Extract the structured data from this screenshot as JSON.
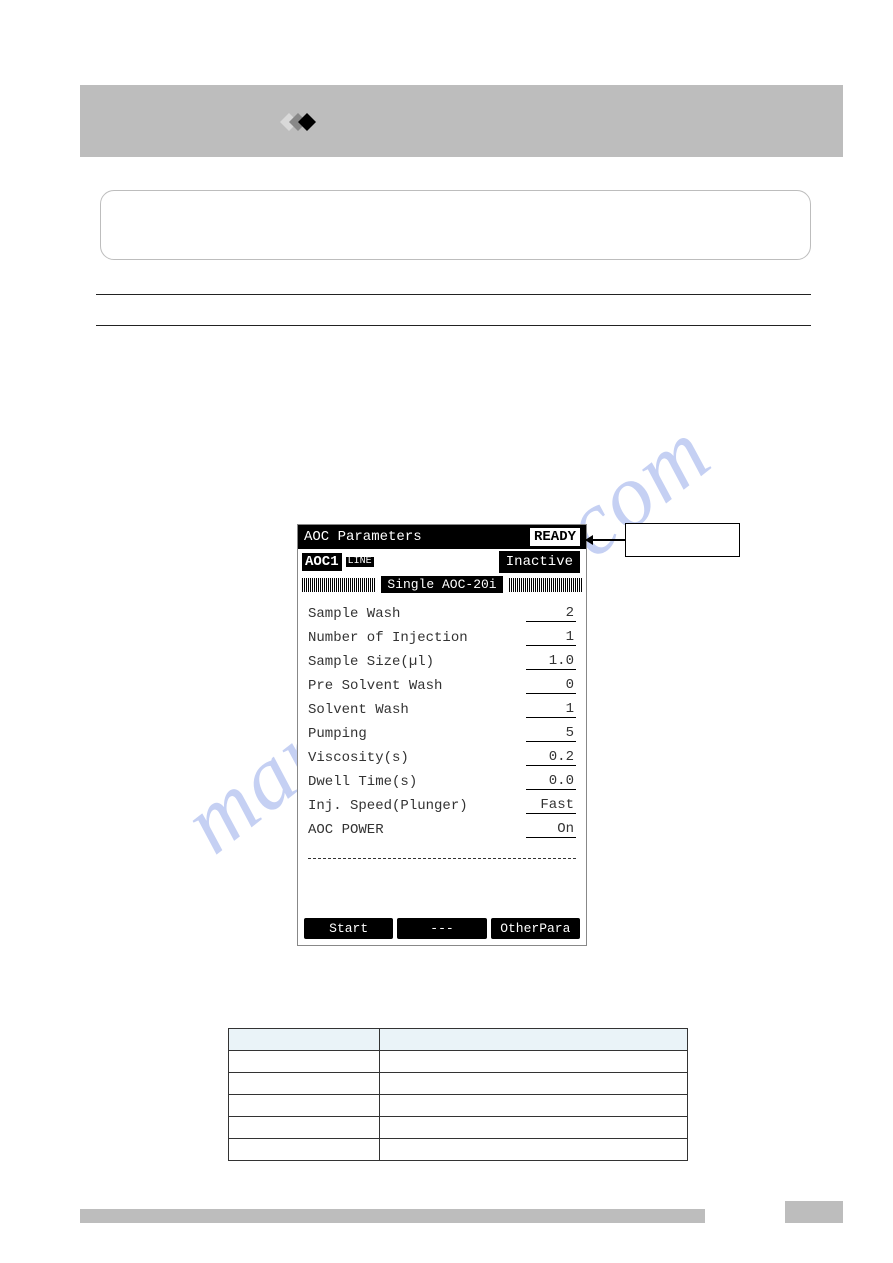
{
  "watermark": "manualslive.com",
  "lcd": {
    "header_title": "AOC Parameters",
    "ready": "READY",
    "aoc1": "AOC1",
    "line_icon": "LINE",
    "inactive": "Inactive",
    "barcode_label": "Single AOC-20i",
    "params": [
      {
        "label": "Sample Wash",
        "value": "2"
      },
      {
        "label": "Number of Injection",
        "value": "1"
      },
      {
        "label": "Sample Size(µl)",
        "value": "1.0"
      },
      {
        "label": "Pre Solvent Wash",
        "value": "0"
      },
      {
        "label": "Solvent Wash",
        "value": "1"
      },
      {
        "label": "Pumping",
        "value": "5"
      },
      {
        "label": "Viscosity(s)",
        "value": "0.2"
      },
      {
        "label": "Dwell Time(s)",
        "value": "0.0"
      },
      {
        "label": "Inj. Speed(Plunger)",
        "value": "Fast"
      },
      {
        "label": "AOC POWER",
        "value": "On"
      }
    ],
    "footer": {
      "left": "Start",
      "mid": "---",
      "right": "OtherPara"
    }
  },
  "table": {
    "headers": [
      "",
      ""
    ],
    "rows": [
      [
        "",
        ""
      ],
      [
        "",
        ""
      ],
      [
        "",
        ""
      ],
      [
        "",
        ""
      ],
      [
        "",
        ""
      ]
    ]
  }
}
